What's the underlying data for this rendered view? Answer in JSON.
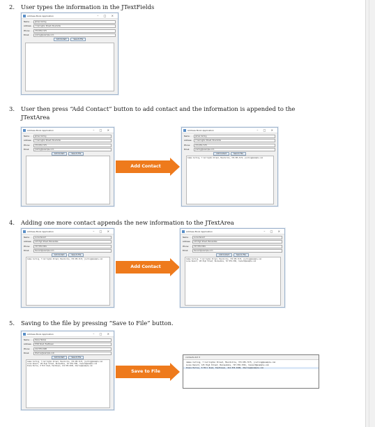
{
  "steps": [
    {
      "num": "2.",
      "text": "User types the information in the JTextFields"
    },
    {
      "num": "3.",
      "text": "User then press “Add Contact” button to add contact and the information is appended to the",
      "cont": "JTextArea"
    },
    {
      "num": "4.",
      "text": "Adding one more contact appends the new information to the JTextArea"
    },
    {
      "num": "5.",
      "text": "Saving to the file by pressing “Save to File” button."
    }
  ],
  "window": {
    "title": "Address Book Application",
    "controls": "– □ ×",
    "labels": {
      "name": "Name:",
      "address": "Address:",
      "phone": "Phone:",
      "email": "Email:"
    },
    "add_button": "Add Contact",
    "save_button": "Save to File"
  },
  "contacts": {
    "a": {
      "name": "James Carling",
      "address": "7 Carrington Street, Mountville",
      "phone": "373-555-7175",
      "email": "jcarling@example.com"
    },
    "b": {
      "name": "Lucas Kenard",
      "address": "125 High Street, Bainesdale",
      "phone": "727-555-3391",
      "email": "lkenard@example.com"
    },
    "c": {
      "name": "Diana Harlow",
      "address": "8 Mill Road, Easthaven",
      "phone": "212-555-0198",
      "email": "dharlow@example.com"
    }
  },
  "arrows": {
    "add": "Add Contact",
    "save": "Save to File"
  },
  "notepad": {
    "tab": "contacts.txt ✕",
    "lines": [
      "James Carling, 7 Carrington Street, Mountville, 373-555-7175, jcarling@example.com",
      "Lucas Kenard, 125 High Street, Bainesdale, 727-555-3391, lkenard@example.com",
      "Diana Harlow, 8 Mill Road, Easthaven, 212-555-0198, dharlow@example.com"
    ]
  },
  "colors": {
    "arrow": "#ee7a1c",
    "window_border": "#9fb4cc",
    "button": "#e6eef7"
  }
}
